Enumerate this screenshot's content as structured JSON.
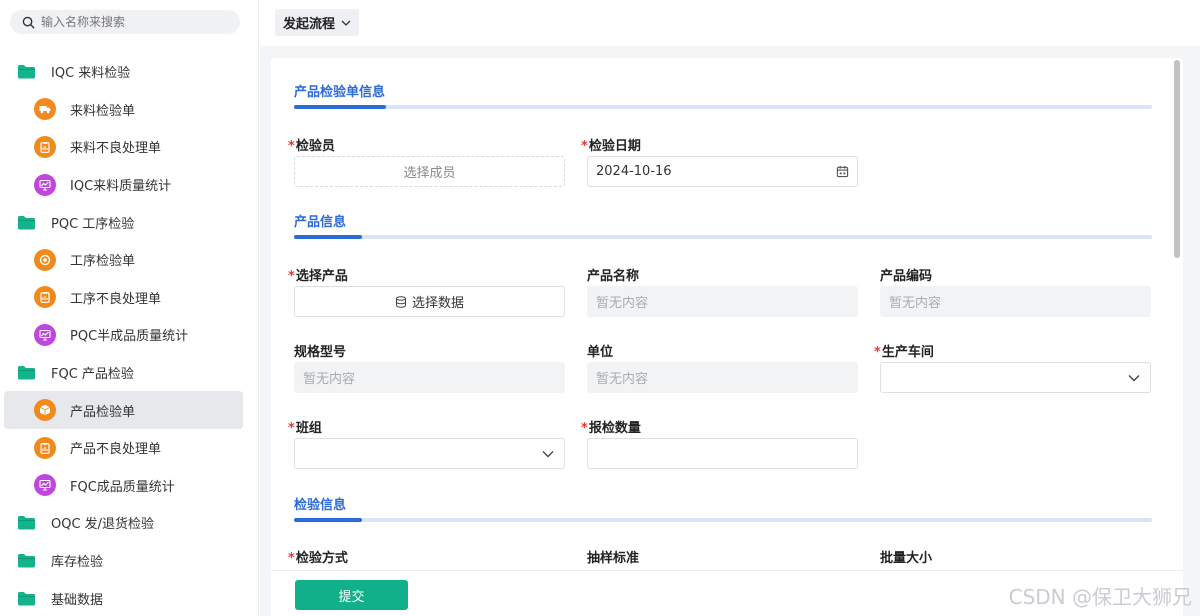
{
  "sidebar": {
    "search_placeholder": "输入名称来搜索",
    "items": [
      {
        "type": "group",
        "label": "IQC 来料检验",
        "icon": "folder-icon"
      },
      {
        "type": "child",
        "label": "来料检验单",
        "icon": "truck-icon",
        "color": "orange"
      },
      {
        "type": "child",
        "label": "来料不良处理单",
        "icon": "clipboard-icon",
        "color": "orange"
      },
      {
        "type": "child",
        "label": "IQC来料质量统计",
        "icon": "chart-icon",
        "color": "purple"
      },
      {
        "type": "group",
        "label": "PQC 工序检验",
        "icon": "folder-icon"
      },
      {
        "type": "child",
        "label": "工序检验单",
        "icon": "target-icon",
        "color": "orange"
      },
      {
        "type": "child",
        "label": "工序不良处理单",
        "icon": "clipboard-icon",
        "color": "orange"
      },
      {
        "type": "child",
        "label": "PQC半成品质量统计",
        "icon": "chart-icon",
        "color": "purple"
      },
      {
        "type": "group",
        "label": "FQC 产品检验",
        "icon": "folder-icon"
      },
      {
        "type": "child",
        "label": "产品检验单",
        "icon": "box-icon",
        "color": "orange",
        "active": true
      },
      {
        "type": "child",
        "label": "产品不良处理单",
        "icon": "clipboard-icon",
        "color": "orange"
      },
      {
        "type": "child",
        "label": "FQC成品质量统计",
        "icon": "chart-icon",
        "color": "purple"
      },
      {
        "type": "group",
        "label": "OQC 发/退货检验",
        "icon": "folder-icon"
      },
      {
        "type": "group",
        "label": "库存检验",
        "icon": "folder-icon"
      },
      {
        "type": "group",
        "label": "基础数据",
        "icon": "folder-icon"
      }
    ]
  },
  "topbar": {
    "flow_label": "发起流程"
  },
  "form": {
    "sec1": {
      "title": "产品检验单信息"
    },
    "inspector": {
      "label": "检验员",
      "placeholder": "选择成员"
    },
    "inspect_date": {
      "label": "检验日期",
      "value": "2024-10-16"
    },
    "sec2": {
      "title": "产品信息"
    },
    "select_product": {
      "label": "选择产品",
      "button": "选择数据"
    },
    "product_name": {
      "label": "产品名称",
      "value": "暂无内容"
    },
    "product_code": {
      "label": "产品编码",
      "value": "暂无内容"
    },
    "spec_model": {
      "label": "规格型号",
      "value": "暂无内容"
    },
    "unit": {
      "label": "单位",
      "value": "暂无内容"
    },
    "workshop": {
      "label": "生产车间",
      "value": ""
    },
    "team": {
      "label": "班组",
      "value": ""
    },
    "qty": {
      "label": "报检数量",
      "value": ""
    },
    "sec3": {
      "title": "检验信息"
    },
    "method": {
      "label": "检验方式"
    },
    "sampling": {
      "label": "抽样标准"
    },
    "batch": {
      "label": "批量大小"
    },
    "required_mark": "*"
  },
  "footer": {
    "submit": "提交"
  },
  "watermark": "CSDN @保卫大狮兄",
  "colors": {
    "accent": "#2c6bd8",
    "submit": "#12b08a",
    "required": "#e53935",
    "orange": "#f28a1b",
    "purple": "#c046e0",
    "folder": "#13b38b"
  }
}
